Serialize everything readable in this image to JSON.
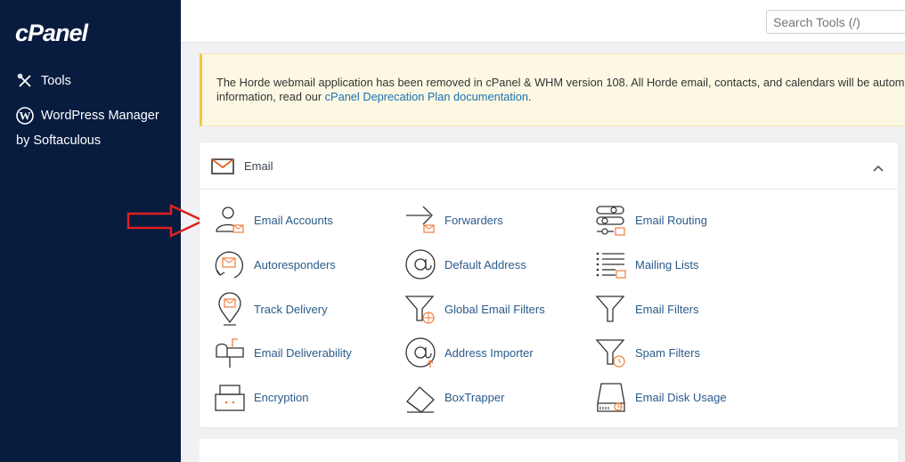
{
  "sidebar": {
    "logo": "cPanel",
    "items": [
      {
        "label": "Tools",
        "icon": "tools-icon"
      },
      {
        "label": "WordPress Manager",
        "icon": "wordpress-icon"
      }
    ],
    "wp_sub_label": "by Softaculous"
  },
  "search": {
    "placeholder": "Search Tools (/)"
  },
  "notice": {
    "line1": "The Horde webmail application has been removed in cPanel & WHM version 108. All Horde email, contacts, and calendars will be automatic",
    "line2_prefix": "information, read our ",
    "link": "cPanel Deprecation Plan documentation",
    "line2_suffix": "."
  },
  "email_panel": {
    "title": "Email",
    "tools": [
      {
        "label": "Email Accounts",
        "icon": "email-accounts-icon"
      },
      {
        "label": "Forwarders",
        "icon": "forwarders-icon"
      },
      {
        "label": "Email Routing",
        "icon": "email-routing-icon"
      },
      {
        "label": "Autoresponders",
        "icon": "autoresponders-icon"
      },
      {
        "label": "Default Address",
        "icon": "default-address-icon"
      },
      {
        "label": "Mailing Lists",
        "icon": "mailing-lists-icon"
      },
      {
        "label": "Track Delivery",
        "icon": "track-delivery-icon"
      },
      {
        "label": "Global Email Filters",
        "icon": "global-filters-icon"
      },
      {
        "label": "Email Filters",
        "icon": "email-filters-icon"
      },
      {
        "label": "Email Deliverability",
        "icon": "deliverability-icon"
      },
      {
        "label": "Address Importer",
        "icon": "address-importer-icon"
      },
      {
        "label": "Spam Filters",
        "icon": "spam-filters-icon"
      },
      {
        "label": "Encryption",
        "icon": "encryption-icon"
      },
      {
        "label": "BoxTrapper",
        "icon": "boxtrapper-icon"
      },
      {
        "label": "Email Disk Usage",
        "icon": "disk-usage-icon"
      }
    ]
  },
  "colors": {
    "sidebar": "#071c3f",
    "accent": "#f07c3a",
    "link": "#2a5a8a",
    "arrow": "#e02020"
  }
}
